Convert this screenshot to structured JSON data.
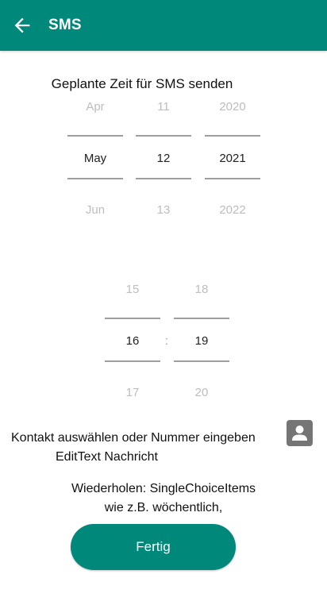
{
  "toolbar": {
    "title": "SMS",
    "back_icon": "arrow-back-icon"
  },
  "schedule": {
    "heading": "Geplante Zeit für SMS senden"
  },
  "date_picker": {
    "month": {
      "prev": "Apr",
      "selected": "May",
      "next": "Jun"
    },
    "day": {
      "prev": "11",
      "selected": "12",
      "next": "13"
    },
    "year": {
      "prev": "2020",
      "selected": "2021",
      "next": "2022"
    }
  },
  "time_picker": {
    "hour": {
      "prev": "15",
      "selected": "16",
      "next": "17"
    },
    "separator": ":",
    "minute": {
      "prev": "18",
      "selected": "19",
      "next": "20"
    }
  },
  "contact": {
    "label": "Kontakt auswählen oder Nummer eingeben",
    "icon": "contact-person-icon"
  },
  "message": {
    "label": "EditText Nachricht"
  },
  "repeat": {
    "line1": "Wiederholen: SingleChoiceItems",
    "line2": "wie z.B. wöchentlich,"
  },
  "actions": {
    "done_label": "Fertig"
  },
  "colors": {
    "accent": "#00897b",
    "faded_text": "#bdbdbd",
    "divider": "#9e9e9e",
    "contact_button": "#757575"
  }
}
